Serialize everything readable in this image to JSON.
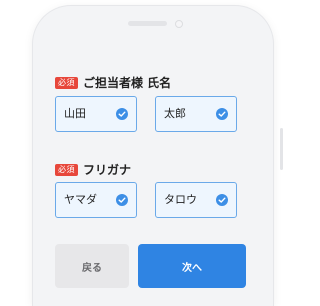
{
  "form": {
    "sections": [
      {
        "required_badge": "必須",
        "label": "ご担当者様 氏名",
        "fields": [
          {
            "value": "山田",
            "icon": "check-circle-icon"
          },
          {
            "value": "太郎",
            "icon": "check-circle-icon"
          }
        ]
      },
      {
        "required_badge": "必須",
        "label": "フリガナ",
        "fields": [
          {
            "value": "ヤマダ",
            "icon": "check-circle-icon"
          },
          {
            "value": "タロウ",
            "icon": "check-circle-icon"
          }
        ]
      }
    ]
  },
  "buttons": {
    "back_label": "戻る",
    "next_label": "次へ"
  },
  "colors": {
    "accent": "#2f84e3",
    "required": "#e7473b",
    "field_border": "#6aa9e9",
    "field_bg": "#eef6fe"
  }
}
